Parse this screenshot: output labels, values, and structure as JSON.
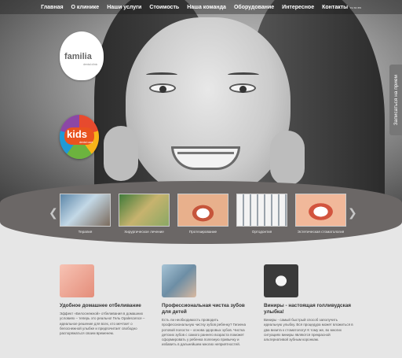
{
  "nav": {
    "items": [
      "Главная",
      "О клинике",
      "Наши услуги",
      "Стоимость",
      "Наша команда",
      "Оборудование",
      "Интересное",
      "Контакты"
    ],
    "contacts_small": "ru ro en"
  },
  "logo": {
    "word": "familia",
    "sub": "dental clinic"
  },
  "kids": {
    "word": "kids",
    "sub": "dental care"
  },
  "side_tab": "Записаться на прием",
  "gallery": [
    "Терапия",
    "Хирургическое лечение",
    "Протезирование",
    "Ортодонтия",
    "Эстетическая стоматология"
  ],
  "cards": [
    {
      "title": "Удобное домашнее отбеливание",
      "text": "Эффект «Белоснежной» отбеливания в домашних условиях – теперь это реально! Гель Opalescence – идеальное решение для всех, кто мечтает о белоснежной улыбке и предпочитает свободно распоряжаться своим временем."
    },
    {
      "title": "Профессиональная чистка зубов для детей",
      "text": "Есть ли необходимость проводить профессиональную чистку зубов ребенку? Гигиена ротовой полости – основа здоровых зубов. Чистка детских зубов с самого раннего возраста поможет сформировать у ребенка полезную привычку и избавить в дальнейшем многих неприятностей."
    },
    {
      "title": "Виниры - настоящая голливудская улыбка!",
      "text": "Виниры - самый быстрый способ заполучить идеальную улыбку. Вся процедура может вложиться в два визита к стоматологу! К тому же, во многих ситуациях виниры являются прекрасной альтернативой зубным коронкам."
    }
  ],
  "colors": {
    "strip": "#6b6766",
    "background": "#e6e6e6",
    "kids_badge": "#e9531f"
  }
}
